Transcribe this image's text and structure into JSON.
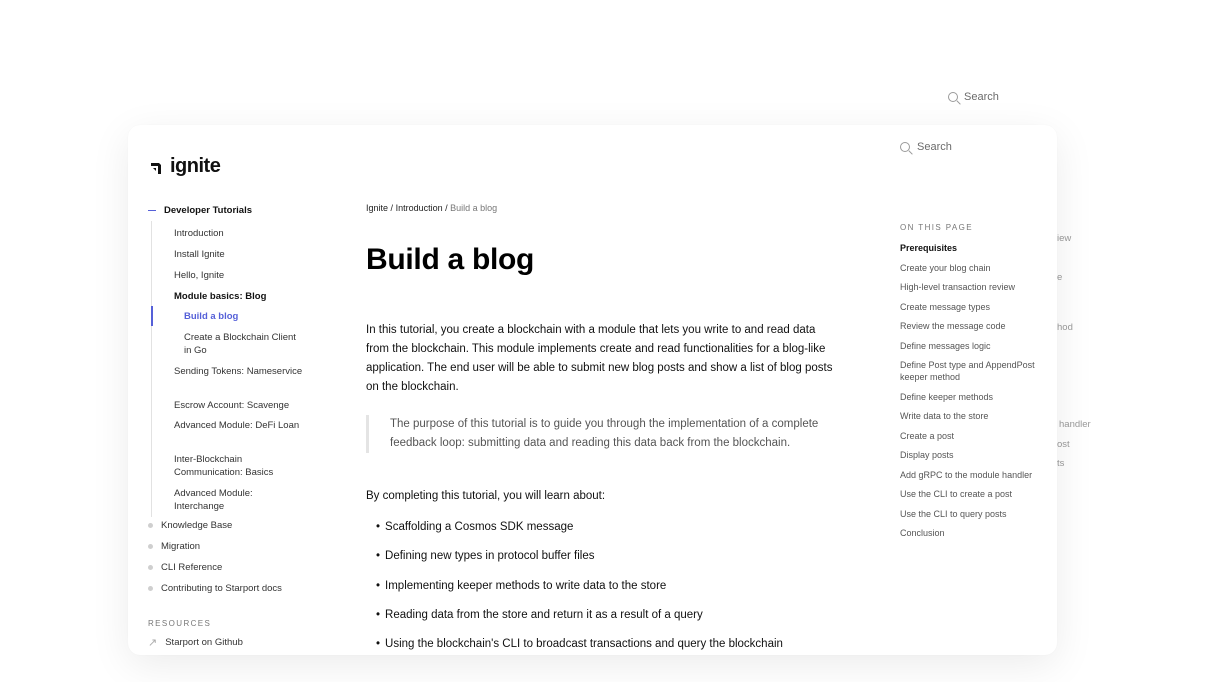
{
  "background_search": {
    "label": "Search"
  },
  "ghost_fragments": [
    "iew",
    "e",
    "hod",
    "handler",
    "ost",
    "ts"
  ],
  "brand": {
    "logo_text": "ignite",
    "accent": "#5560d8"
  },
  "nav": {
    "section_title": "Developer Tutorials",
    "items": [
      {
        "label": "Introduction"
      },
      {
        "label": "Install Ignite"
      },
      {
        "label": "Hello, Ignite"
      },
      {
        "label": "Module basics: Blog"
      },
      {
        "label": "Build a blog"
      },
      {
        "label": "Create a Blockchain Client in Go"
      },
      {
        "label": "Sending Tokens: Nameservice"
      },
      {
        "label": "Escrow Account: Scavenge"
      },
      {
        "label": "Advanced Module: DeFi Loan"
      },
      {
        "label": "Inter-Blockchain Communication: Basics"
      },
      {
        "label": "Advanced Module: Interchange"
      }
    ],
    "other_sections": [
      {
        "label": "Knowledge Base"
      },
      {
        "label": "Migration"
      },
      {
        "label": "CLI Reference"
      },
      {
        "label": "Contributing to Starport docs"
      }
    ],
    "resources_label": "RESOURCES",
    "resources": [
      {
        "label": "Starport on Github"
      }
    ]
  },
  "breadcrumb": {
    "root": "Ignite",
    "sep": "/",
    "section": "Introduction",
    "current": "Build a blog"
  },
  "page": {
    "title": "Build a blog",
    "intro": "In this tutorial, you create a blockchain with a module that lets you write to and read data from the blockchain. This module implements create and read functionalities for a blog-like application. The end user will be able to submit new blog posts and show a list of blog posts on the blockchain.",
    "quote": "The purpose of this tutorial is to guide you through the implementation of a complete feedback loop: submitting data and reading this data back from the blockchain.",
    "learn_intro": "By completing this tutorial, you will learn about:",
    "bullets": [
      "Scaffolding a Cosmos SDK message",
      "Defining new types in protocol buffer files",
      "Implementing keeper methods to write data to the store",
      "Reading data from the store and return it as a result of a query",
      "Using the blockchain's CLI to broadcast transactions and query the blockchain"
    ]
  },
  "search": {
    "label": "Search"
  },
  "toc": {
    "label": "ON THIS PAGE",
    "items": [
      "Prerequisites",
      "Create your blog chain",
      "High-level transaction review",
      "Create message types",
      "Review the message code",
      "Define messages logic",
      "Define Post type and AppendPost keeper method",
      "Define keeper methods",
      "Write data to the store",
      "Create a post",
      "Display posts",
      "Add gRPC to the module handler",
      "Use the CLI to create a post",
      "Use the CLI to query posts",
      "Conclusion"
    ]
  }
}
